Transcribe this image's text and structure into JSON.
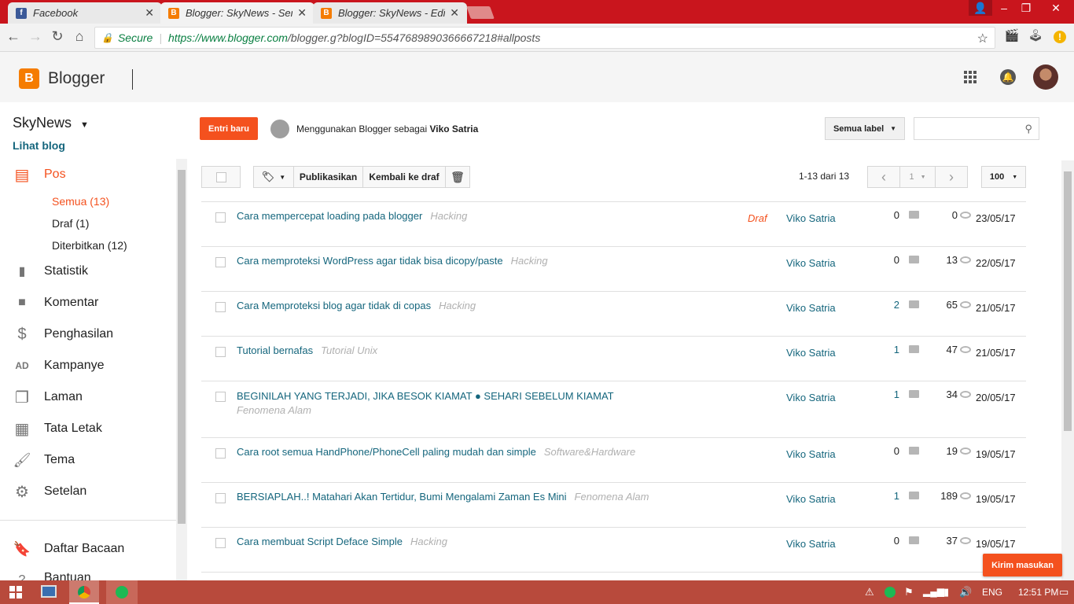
{
  "browser": {
    "tabs": [
      {
        "title": "Facebook",
        "favicon": "facebook-icon",
        "active": false
      },
      {
        "title": "Blogger: SkyNews - Sem",
        "favicon": "blogger-icon",
        "active": true
      },
      {
        "title": "Blogger: SkyNews - Edi",
        "favicon": "blogger-icon",
        "active": false
      }
    ],
    "secure_label": "Secure",
    "url_host": "https://www.blogger.com",
    "url_path": "/blogger.g?blogID=5547689890366667218#allposts"
  },
  "header": {
    "app_name": "Blogger"
  },
  "sidebar": {
    "blog_name": "SkyNews",
    "view_blog": "Lihat blog",
    "posts_label": "Pos",
    "sub_items": [
      "Semua (13)",
      "Draf (1)",
      "Diterbitkan (12)"
    ],
    "items": [
      {
        "label": "Statistik",
        "icon": "bar-chart-icon"
      },
      {
        "label": "Komentar",
        "icon": "comment-icon"
      },
      {
        "label": "Penghasilan",
        "icon": "dollar-icon"
      },
      {
        "label": "Kampanye",
        "icon": "ad-icon"
      },
      {
        "label": "Laman",
        "icon": "pages-icon"
      },
      {
        "label": "Tata Letak",
        "icon": "layout-icon"
      },
      {
        "label": "Tema",
        "icon": "paint-roller-icon"
      },
      {
        "label": "Setelan",
        "icon": "gear-icon"
      }
    ],
    "reading_list": "Daftar Bacaan",
    "help": "Bantuan"
  },
  "main": {
    "new_post": "Entri baru",
    "using_as_prefix": "Menggunakan Blogger sebagai",
    "using_as_name": "Viko Satria",
    "label_filter": "Semua label",
    "publish": "Publikasikan",
    "revert_draft": "Kembali ke draf",
    "range": "1-13 dari 13",
    "page": "1",
    "per_page": "100",
    "feedback": "Kirim masukan",
    "posts": [
      {
        "title": "Cara mempercepat loading pada blogger",
        "label": "Hacking",
        "status": "Draf",
        "author": "Viko Satria",
        "comments": "0",
        "views": "0",
        "date": "23/05/17"
      },
      {
        "title": "Cara memproteksi WordPress agar tidak bisa dicopy/paste",
        "label": "Hacking",
        "status": "",
        "author": "Viko Satria",
        "comments": "0",
        "views": "13",
        "date": "22/05/17"
      },
      {
        "title": "Cara Memproteksi blog agar tidak di copas",
        "label": "Hacking",
        "status": "",
        "author": "Viko Satria",
        "comments": "2",
        "views": "65",
        "date": "21/05/17"
      },
      {
        "title": "Tutorial bernafas",
        "label": "Tutorial Unix",
        "status": "",
        "author": "Viko Satria",
        "comments": "1",
        "views": "47",
        "date": "21/05/17"
      },
      {
        "title": "BEGINILAH YANG TERJADI, JIKA BESOK KIAMAT ● SEHARI SEBELUM KIAMAT",
        "label": "Fenomena Alam",
        "status": "",
        "author": "Viko Satria",
        "comments": "1",
        "views": "34",
        "date": "20/05/17"
      },
      {
        "title": "Cara root semua HandPhone/PhoneCell paling mudah dan simple",
        "label": "Software&Hardware",
        "status": "",
        "author": "Viko Satria",
        "comments": "0",
        "views": "19",
        "date": "19/05/17"
      },
      {
        "title": "BERSIAPLAH..! Matahari Akan Tertidur, Bumi Mengalami Zaman Es Mini",
        "label": "Fenomena Alam",
        "status": "",
        "author": "Viko Satria",
        "comments": "1",
        "views": "189",
        "date": "19/05/17"
      },
      {
        "title": "Cara membuat Script Deface Simple",
        "label": "Hacking",
        "status": "",
        "author": "Viko Satria",
        "comments": "0",
        "views": "37",
        "date": "19/05/17"
      }
    ]
  },
  "taskbar": {
    "lang": "ENG",
    "time": "12:51 PM"
  },
  "colors": {
    "accent": "#f4511e",
    "link": "#15667d",
    "chrome_red": "#c9151d"
  }
}
